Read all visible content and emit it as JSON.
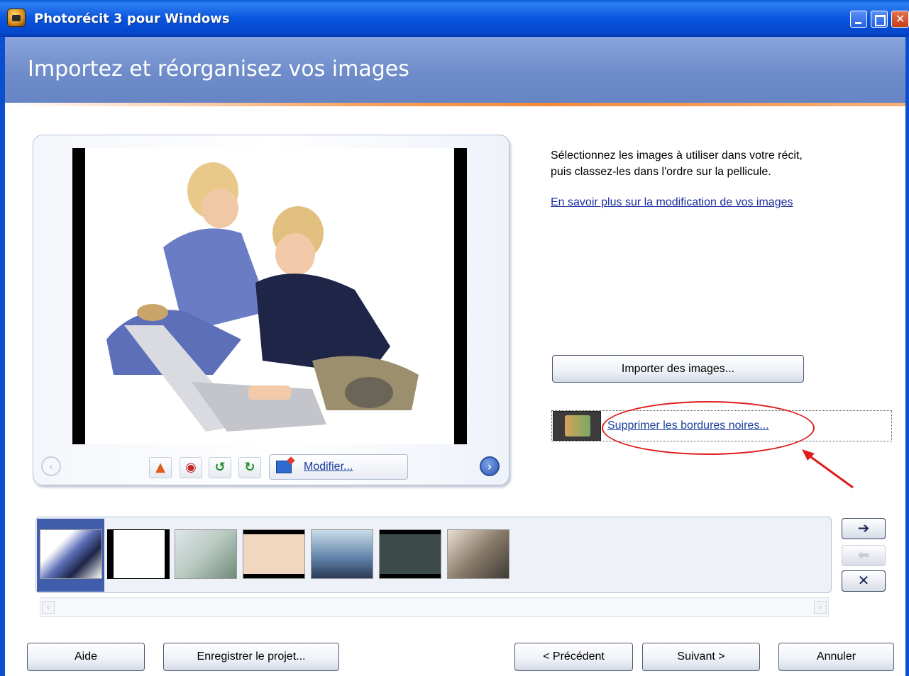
{
  "window": {
    "title": "Photorécit 3 pour Windows"
  },
  "header": {
    "heading": "Importez et réorganisez vos images"
  },
  "preview": {
    "modify_label": "Modifier..."
  },
  "instructions": {
    "line1": "Sélectionnez les images à utiliser dans votre récit,",
    "line2": "puis classez-les dans l'ordre sur la pellicule.",
    "learn_more_link": "En savoir plus sur la modification de vos images"
  },
  "actions": {
    "import_label": "Importer des images...",
    "remove_borders_label": "Supprimer les bordures noires..."
  },
  "filmstrip": {
    "selected_index": 0,
    "thumbnail_count": 7
  },
  "footer": {
    "help_label": "Aide",
    "save_label": "Enregistrer le projet...",
    "previous_label": "< Précédent",
    "next_label": "Suivant >",
    "cancel_label": "Annuler"
  },
  "colors": {
    "titlebar": "#0855dd",
    "banner": "#6f8cca",
    "accent_stripe": "#f28a3a",
    "link": "#1b3f9c",
    "annotation": "#e01b1b"
  }
}
